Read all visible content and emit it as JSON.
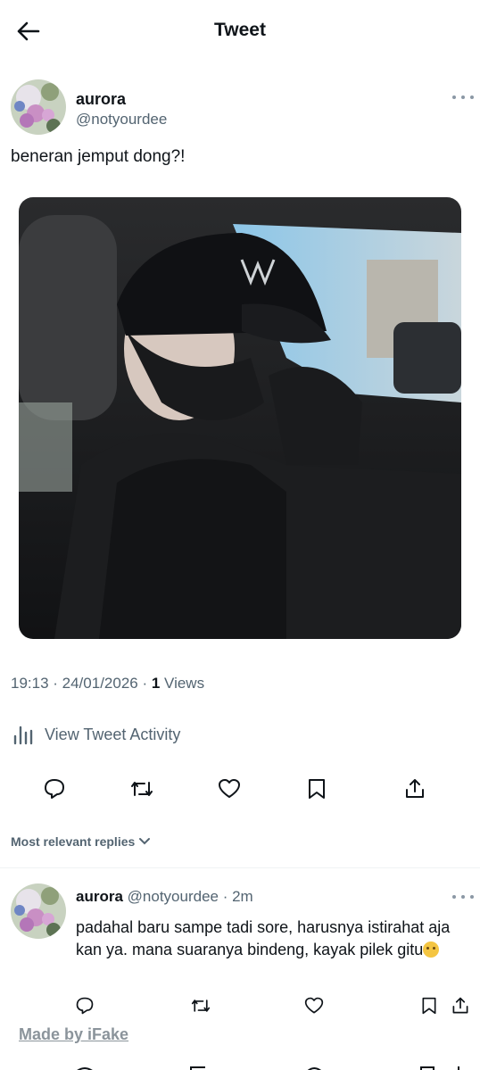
{
  "header": {
    "title": "Tweet",
    "back_icon": "arrow-left-icon"
  },
  "tweet": {
    "author_name": "aurora",
    "handle": "@notyourdee",
    "text": "beneran jemput dong?!",
    "time": "19:13 · 24/01/2026 · ",
    "views_count": "1",
    "views_label": " Views",
    "activity_label": "View Tweet Activity",
    "actions": [
      "reply-icon",
      "retweet-icon",
      "like-icon",
      "bookmark-icon",
      "share-icon"
    ]
  },
  "replies": {
    "sort_label": "Most relevant replies",
    "items": [
      {
        "name": "aurora",
        "handle": "@notyourdee",
        "dot": " · ",
        "time": "2m",
        "text": "padahal baru sampe tadi sore, harusnya istirahat aja kan ya. mana suaranya bindeng, kayak pilek gitu",
        "emoji": "crying-face"
      }
    ]
  },
  "watermark": "Made by iFake",
  "colors": {
    "text": "#0f1419",
    "secondary": "#536471",
    "divider": "#eff3f4",
    "background": "#ffffff"
  }
}
